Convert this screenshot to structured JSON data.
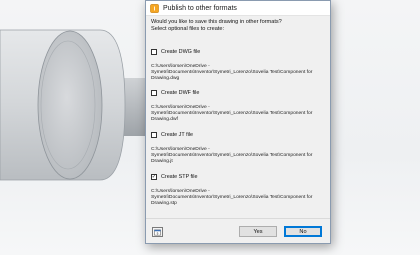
{
  "dialog": {
    "title": "Publish to other formats",
    "question": "Would you like to save this drawing in other formats?",
    "subprompt": "Select optional files to create:",
    "options": [
      {
        "label": "Create DWG file",
        "checked": false,
        "path": "C:\\Users\\lorsen\\OneDrive - Symetri\\Documents\\Inventor\\Symetri_Lorenzo\\Sovelia Test\\Component for Drawing.dwg"
      },
      {
        "label": "Create DWF file",
        "checked": false,
        "path": "C:\\Users\\lorsen\\OneDrive - Symetri\\Documents\\Inventor\\Symetri_Lorenzo\\Sovelia Test\\Component for Drawing.dwf"
      },
      {
        "label": "Create JT file",
        "checked": false,
        "path": "C:\\Users\\lorsen\\OneDrive - Symetri\\Documents\\Inventor\\Symetri_Lorenzo\\Sovelia Test\\Component for Drawing.jt"
      },
      {
        "label": "Create STP file",
        "checked": true,
        "path": "C:\\Users\\lorsen\\OneDrive - Symetri\\Documents\\Inventor\\Symetri_Lorenzo\\Sovelia Test\\Component for Drawing.stp"
      }
    ],
    "buttons": {
      "yes": "Yes",
      "no": "No"
    },
    "help_icon": "help-icon"
  },
  "colors": {
    "accent": "#0078d7",
    "dialog_bg": "#f0f0f0",
    "title_bg": "#ffffff"
  }
}
